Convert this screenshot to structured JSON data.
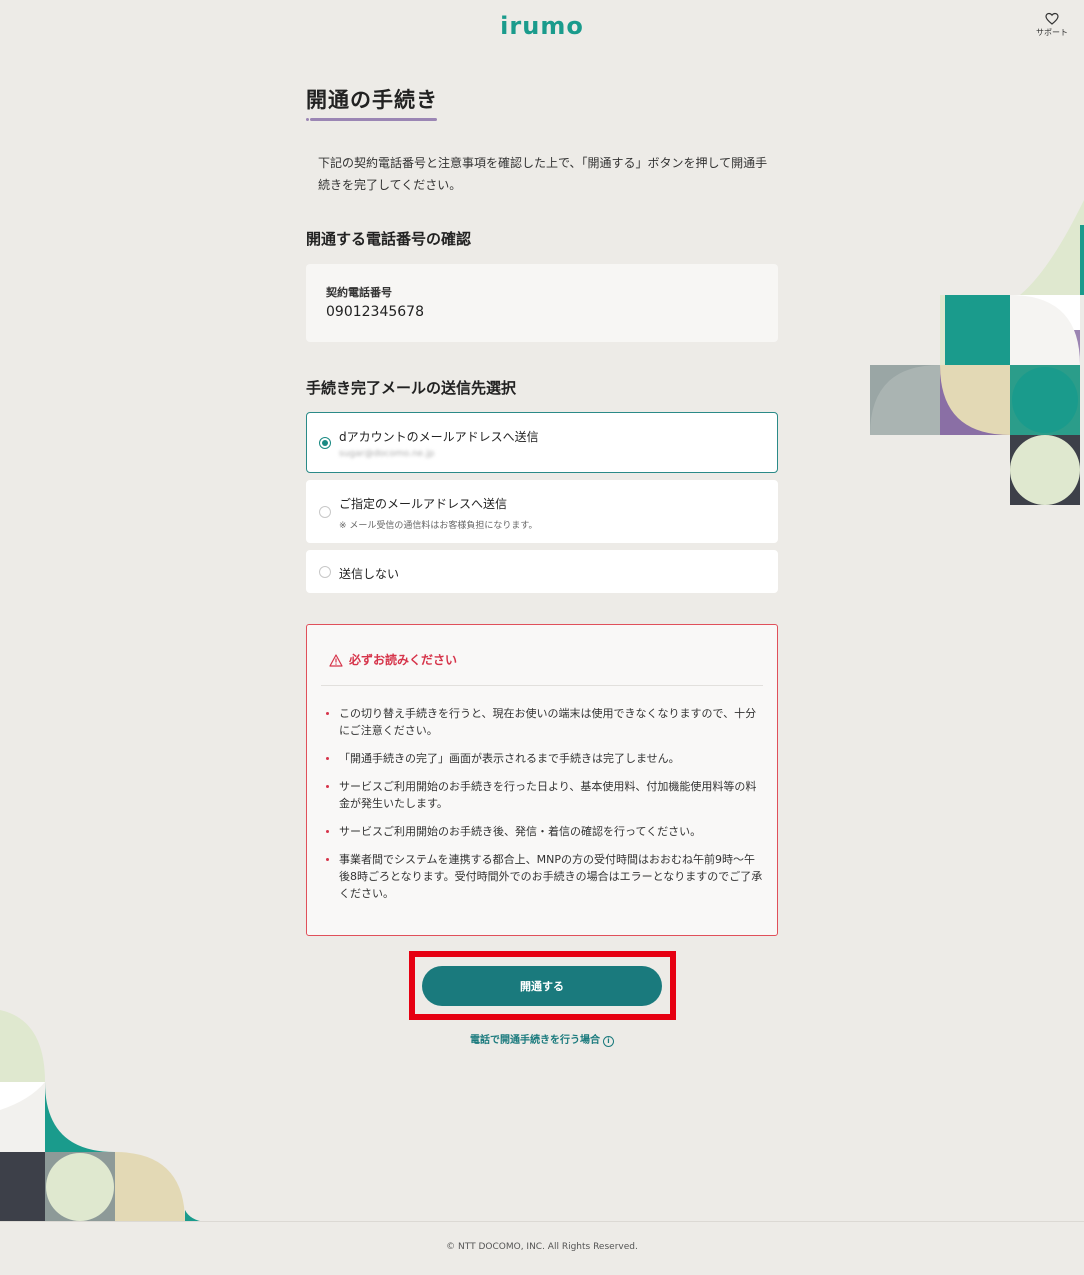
{
  "header": {
    "logo": "irumo",
    "support_label": "サポート"
  },
  "page": {
    "title": "開通の手続き",
    "intro": "下記の契約電話番号と注意事項を確認した上で、「開通する」ボタンを押して開通手続きを完了してください。"
  },
  "phone_section": {
    "heading": "開通する電話番号の確認",
    "label": "契約電話番号",
    "number": "09012345678"
  },
  "mail_section": {
    "heading": "手続き完了メールの送信先選択",
    "options": [
      {
        "label": "dアカウントのメールアドレスへ送信",
        "sub": "sugar@docomo.ne.jp",
        "selected": true
      },
      {
        "label": "ご指定のメールアドレスへ送信",
        "sub": "※ メール受信の通信料はお客様負担になります。",
        "selected": false
      },
      {
        "label": "送信しない",
        "selected": false
      }
    ]
  },
  "notice": {
    "heading": "必ずお読みください",
    "items": [
      "この切り替え手続きを行うと、現在お使いの端末は使用できなくなりますので、十分にご注意ください。",
      "「開通手続きの完了」画面が表示されるまで手続きは完了しません。",
      "サービスご利用開始のお手続きを行った日より、基本使用料、付加機能使用料等の料金が発生いたします。",
      "サービスご利用開始のお手続き後、発信・着信の確認を行ってください。",
      "事業者間でシステムを連携する都合上、MNPの方の受付時間はおおむね午前9時〜午後8時ごろとなります。受付時間外でのお手続きの場合はエラーとなりますのでご了承ください。"
    ]
  },
  "actions": {
    "primary_label": "開通する",
    "phone_link": "電話で開通手続きを行う場合"
  },
  "footer": {
    "copyright": "© NTT DOCOMO, INC. All Rights Reserved."
  },
  "colors": {
    "accent": "#1a7a7d",
    "warning": "#d6344a",
    "highlight": "#e60012",
    "title_underline": "#9b86b4"
  }
}
